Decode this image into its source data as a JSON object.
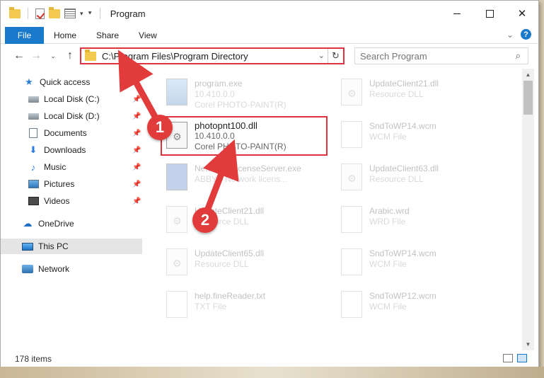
{
  "window": {
    "title": "Program"
  },
  "ribbon": {
    "file": "File",
    "home": "Home",
    "share": "Share",
    "view": "View",
    "help": "?"
  },
  "address": {
    "path": "C:\\Program Files\\Program Directory"
  },
  "search": {
    "placeholder": "Search Program"
  },
  "sidebar": {
    "quick_access": "Quick access",
    "items": [
      {
        "label": "Local Disk (C:)"
      },
      {
        "label": "Local Disk (D:)"
      },
      {
        "label": "Documents"
      },
      {
        "label": "Downloads"
      },
      {
        "label": "Music"
      },
      {
        "label": "Pictures"
      },
      {
        "label": "Videos"
      }
    ],
    "onedrive": "OneDrive",
    "this_pc": "This PC",
    "network": "Network"
  },
  "files": {
    "left": [
      {
        "name": "program.exe",
        "line2": "10.410.0.0",
        "line3": "Corel PHOTO-PAINT(R)"
      },
      {
        "name": "Network&LicenseServer.exe",
        "line2": "ABBYY Network licens..."
      },
      {
        "name": "UpdateClient21.dll",
        "line2": "Resource DLL"
      },
      {
        "name": "UpdateClient65.dll",
        "line2": "Resource DLL"
      },
      {
        "name": "help.fineReader.txt",
        "line2": "TXT File"
      }
    ],
    "right": [
      {
        "name": "UpdateClient21.dll",
        "line2": "Resource DLL"
      },
      {
        "name": "SndToWP14.wcm",
        "line2": "WCM File"
      },
      {
        "name": "UpdateClient63.dll",
        "line2": "Resource DLL"
      },
      {
        "name": "Arabic.wrd",
        "line2": "WRD File"
      },
      {
        "name": "SndToWP14.wcm",
        "line2": "WCM File"
      },
      {
        "name": "SndToWP12.wcm",
        "line2": "WCM File"
      }
    ],
    "selected": {
      "name": "photopnt100.dll",
      "line2": "10.410.0.0",
      "line3": "Corel PHOTO-PAINT(R)"
    }
  },
  "status": {
    "count": "178 items"
  },
  "annotations": {
    "step1": "1",
    "step2": "2"
  }
}
